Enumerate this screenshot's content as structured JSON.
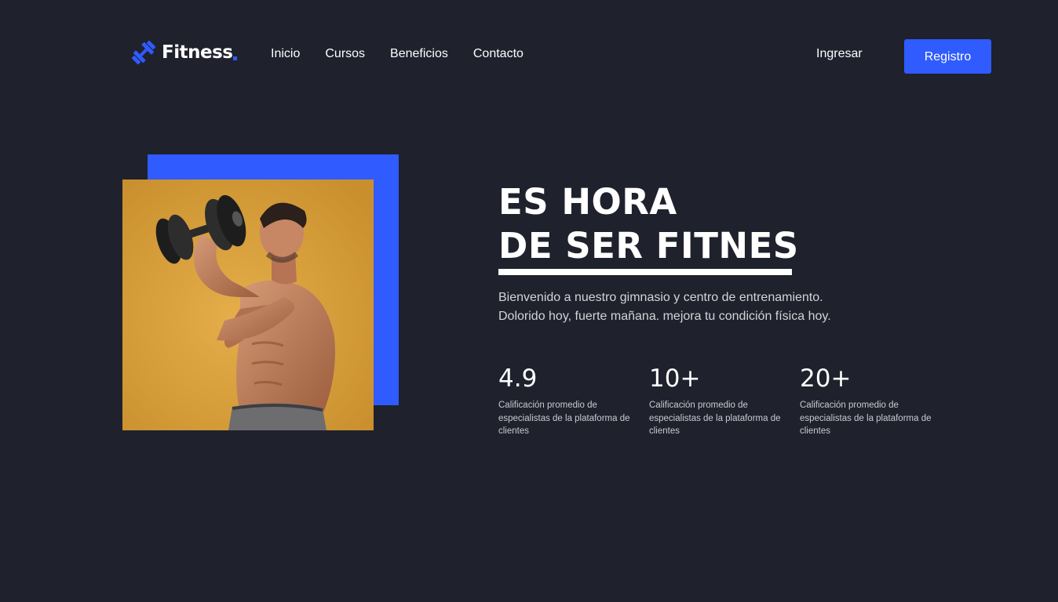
{
  "brand": {
    "name": "Fitness",
    "accent_color": "#2f5bff",
    "background_color": "#1f212c",
    "logo_icon": "dumbbell-icon"
  },
  "nav": {
    "links": [
      "Inicio",
      "Cursos",
      "Beneficios",
      "Contacto"
    ]
  },
  "header": {
    "login_label": "Ingresar",
    "register_label": "Registro"
  },
  "hero": {
    "title_line_1": "ES HORA",
    "title_line_2": "DE SER FITNES",
    "description_line_1": "Bienvenido a nuestro gimnasio y centro de entrenamiento.",
    "description_line_2": "Dolorido hoy, fuerte mañana. mejora tu condición física hoy.",
    "image": "man-lifting-dumbbell-photo"
  },
  "stats": [
    {
      "value": "4.9",
      "label": "Calificación promedio de especialistas de la plataforma de clientes"
    },
    {
      "value": "10+",
      "label": "Calificación promedio de especialistas de la plataforma de clientes"
    },
    {
      "value": "20+",
      "label": "Calificación promedio de especialistas de la plataforma de clientes"
    }
  ]
}
